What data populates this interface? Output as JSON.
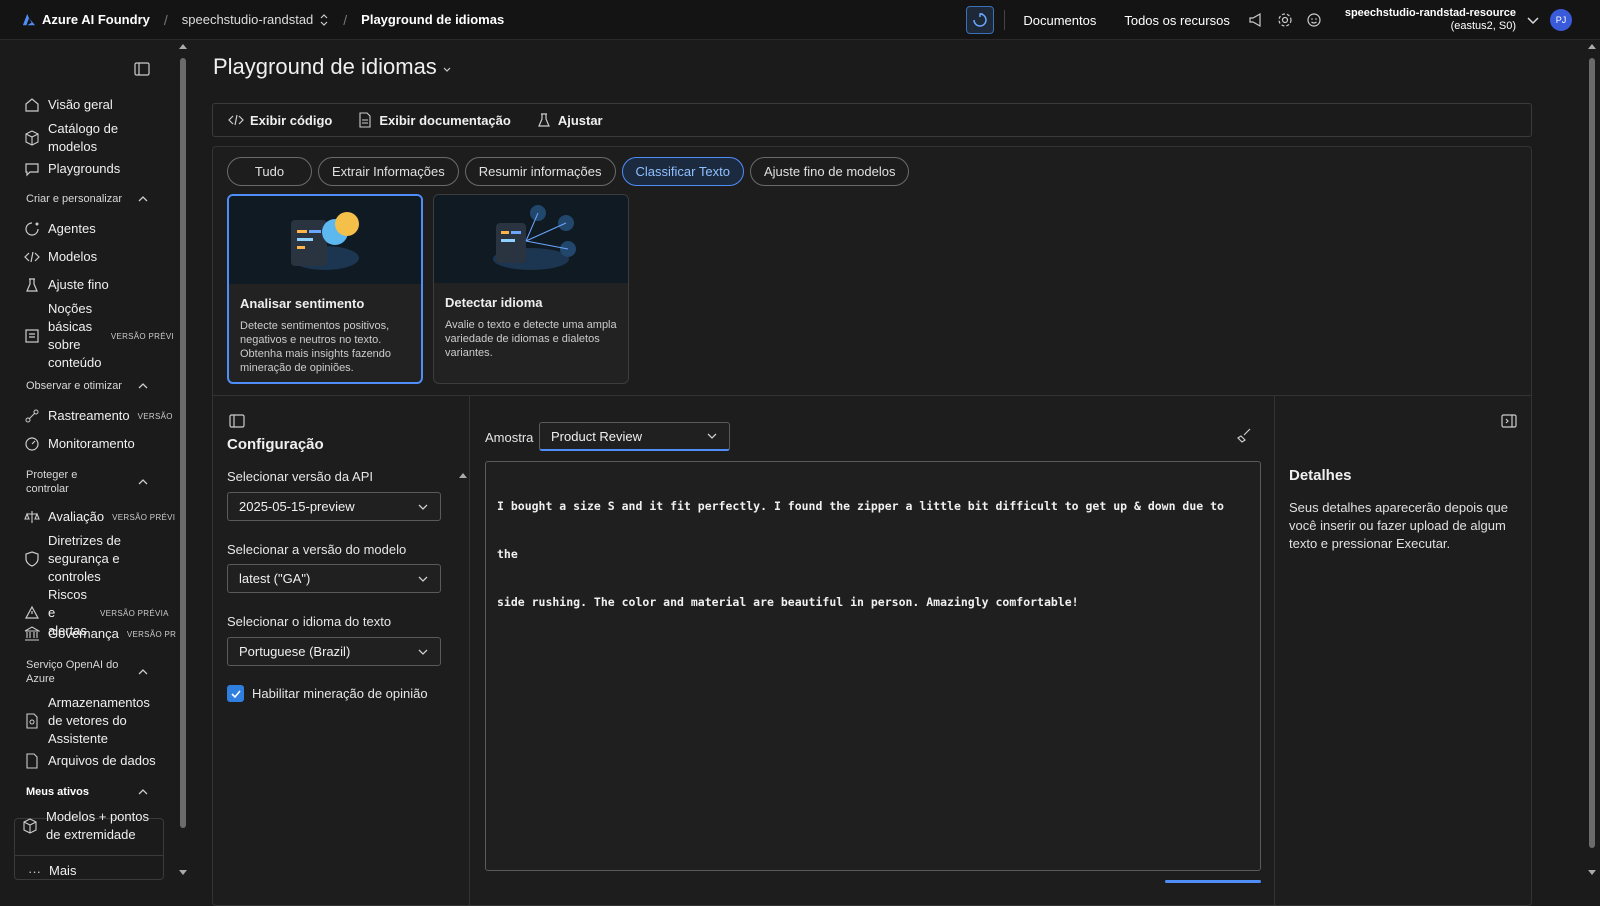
{
  "header": {
    "brand": "Azure AI Foundry",
    "project": "speechstudio-randstad",
    "current_page": "Playground de idiomas",
    "links": [
      "Documentos",
      "Todos os recursos"
    ],
    "resource_name": "speechstudio-randstad-resource",
    "resource_region": "(eastus2, S0)",
    "avatar_initials": "PJ"
  },
  "sidebar": {
    "top_items": [
      "Visão geral",
      "Catálogo de modelos",
      "Playgrounds"
    ],
    "sections": [
      {
        "title": "Criar e personalizar",
        "items": [
          "Agentes",
          "Modelos",
          "Ajuste fino",
          "Noções básicas sobre conteúdo"
        ]
      },
      {
        "title": "Observar e otimizar",
        "items": [
          "Rastreamento",
          "Monitoramento"
        ]
      },
      {
        "title": "Proteger e controlar",
        "items": [
          "Avaliação",
          "Diretrizes de segurança e controles",
          "Riscos e alertas",
          "Governança"
        ]
      },
      {
        "title": "Serviço OpenAI do Azure",
        "items": [
          "Armazenamentos de vetores do Assistente",
          "Arquivos de dados"
        ]
      },
      {
        "title": "Meus ativos",
        "items": [
          "Modelos + pontos de extremidade"
        ]
      }
    ],
    "badges": {
      "preview_full": "VERSÃO PRÉVIA",
      "preview_cut": "VERSÃO PRÉVI",
      "preview_short": "VERSÃO",
      "preview_pr": "VERSÃO PR"
    },
    "more": "Mais"
  },
  "page": {
    "title": "Playground de idiomas",
    "toolbar": [
      "Exibir código",
      "Exibir documentação",
      "Ajustar"
    ],
    "filters": [
      "Tudo",
      "Extrair Informações",
      "Resumir informações",
      "Classificar Texto",
      "Ajuste fino de modelos"
    ],
    "active_filter": "Classificar Texto",
    "cards": [
      {
        "title": "Analisar sentimento",
        "desc": "Detecte sentimentos positivos, negativos e neutros no texto. Obtenha mais insights fazendo mineração de opiniões."
      },
      {
        "title": "Detectar idioma",
        "desc": "Avalie o texto e detecte uma ampla variedade de idiomas e dialetos variantes."
      }
    ]
  },
  "config": {
    "title": "Configuração",
    "api_label": "Selecionar versão da API",
    "api_value": "2025-05-15-preview",
    "model_label": "Selecionar a versão do modelo",
    "model_value": "latest (\"GA\")",
    "lang_label": "Selecionar o idioma do texto",
    "lang_value": "Portuguese (Brazil)",
    "opinion_label": "Habilitar mineração de opinião",
    "opinion_checked": true
  },
  "sample": {
    "label": "Amostra",
    "value": "Product Review",
    "text_line1": "I bought a size S and it fit perfectly. I found the zipper a little bit difficult to get up & down due to the",
    "text_line2": "side rushing. The color and material are beautiful in person. Amazingly comfortable!"
  },
  "details": {
    "title": "Detalhes",
    "text": "Seus detalhes aparecerão depois que você inserir ou fazer upload de algum texto e pressionar Executar."
  },
  "colors": {
    "accent": "#4f8ef7",
    "bg": "#1b1b1b",
    "panel": "#1d1d1d"
  }
}
